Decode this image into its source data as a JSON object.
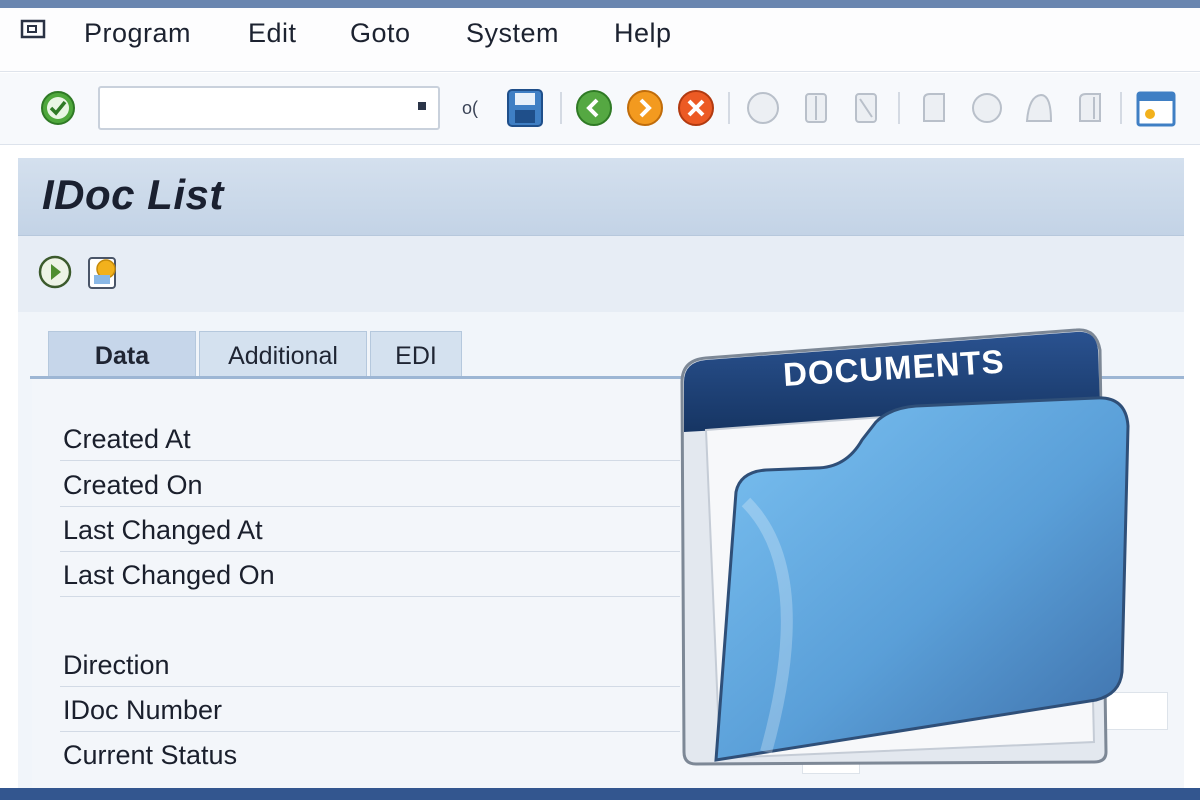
{
  "menu": {
    "items": [
      "Program",
      "Edit",
      "Goto",
      "System",
      "Help"
    ]
  },
  "toolbar": {
    "command_value": "",
    "command_placeholder": "",
    "sep_label": "o("
  },
  "page": {
    "title": "IDoc List"
  },
  "tabs": [
    {
      "label": "Data",
      "active": true
    },
    {
      "label": "Additional",
      "active": false
    },
    {
      "label": "EDI",
      "active": false
    }
  ],
  "fields": [
    {
      "label": "Created At"
    },
    {
      "label": "Created On"
    },
    {
      "label": "Last Changed At"
    },
    {
      "label": "Last Changed On"
    },
    {
      "label": "Direction"
    },
    {
      "label": "IDoc Number"
    },
    {
      "label": "Current Status"
    }
  ],
  "illustration": {
    "folder_tab_text": "DOCUMENTS"
  },
  "colors": {
    "accent": "#33568f",
    "title_band": "#c3d3e6",
    "folder_blue": "#5ea9e6",
    "folder_tab": "#1f3f73"
  }
}
